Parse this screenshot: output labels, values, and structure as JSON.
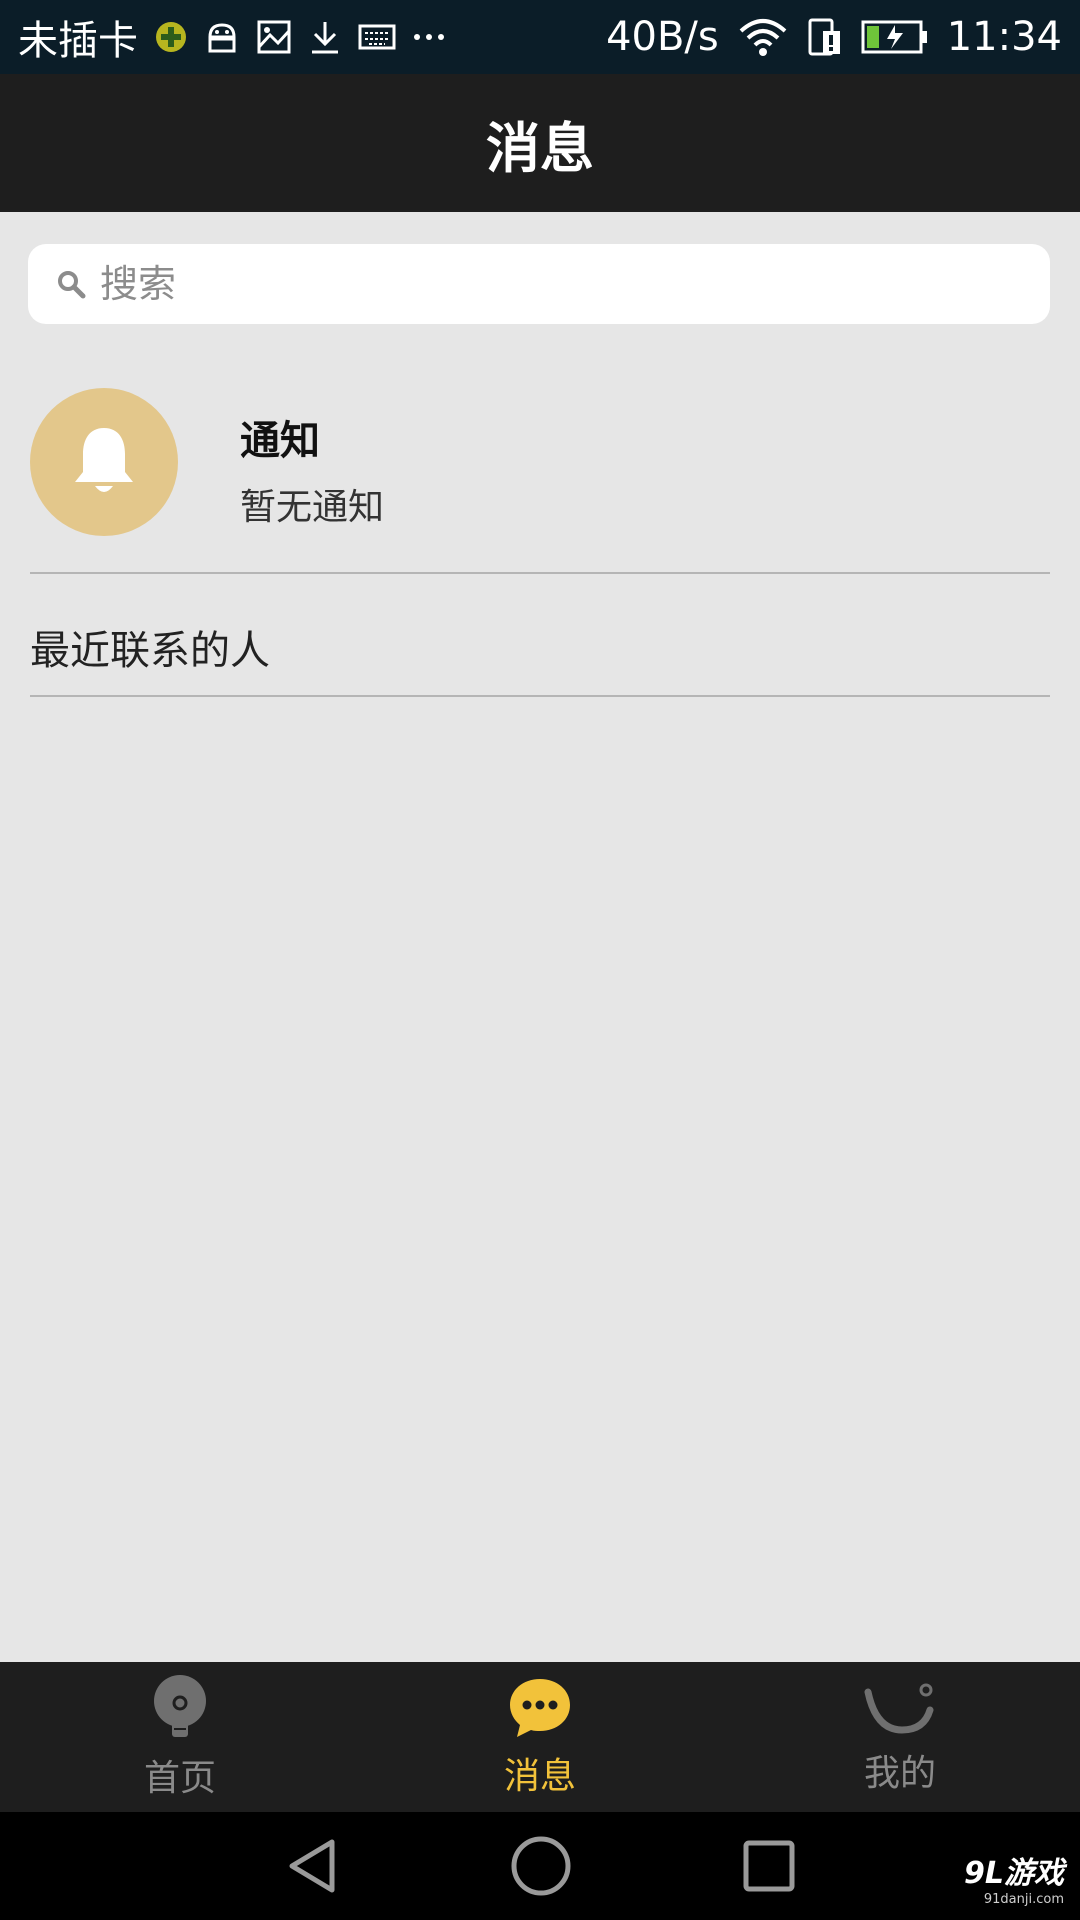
{
  "status_bar": {
    "carrier": "未插卡",
    "speed": "40B/s",
    "time": "11:34",
    "icons": [
      "security-plus-icon",
      "android-icon",
      "image-icon",
      "download-icon",
      "keyboard-icon",
      "more-dots-icon",
      "wifi-icon",
      "sim-icon",
      "battery-charging-icon"
    ]
  },
  "header": {
    "title": "消息"
  },
  "search": {
    "placeholder": "搜索"
  },
  "notification": {
    "title": "通知",
    "subtitle": "暂无通知",
    "avatar_color": "#e3c78b",
    "icon": "bell-icon"
  },
  "recent": {
    "label": "最近联系的人"
  },
  "tabs": [
    {
      "label": "首页",
      "icon": "bulb-icon",
      "active": false
    },
    {
      "label": "消息",
      "icon": "chat-bubble-icon",
      "active": true
    },
    {
      "label": "我的",
      "icon": "smile-icon",
      "active": false
    }
  ],
  "colors": {
    "accent": "#f2c23a",
    "tab_inactive": "#8a8a8a",
    "header_bg": "#1e1e1e",
    "page_bg": "#e6e6e6"
  },
  "watermark": {
    "main": "9L游戏",
    "sub": "91danji.com"
  }
}
